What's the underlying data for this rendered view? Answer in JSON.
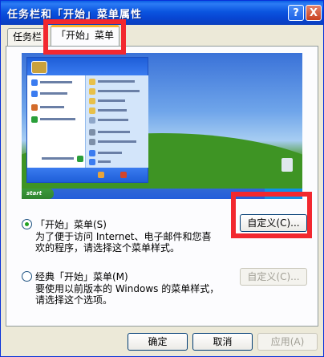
{
  "window": {
    "title": "任务栏和「开始」菜单属性",
    "help_label": "?",
    "close_label": "X"
  },
  "tabs": [
    {
      "label": "任务栏",
      "active": false
    },
    {
      "label": "「开始」菜单",
      "active": true
    }
  ],
  "preview": {
    "start_label": "start",
    "colors": {
      "sky": "#3a72d8",
      "grass": "#2f7e1c",
      "taskbar": "#245edb"
    }
  },
  "options": [
    {
      "label": "「开始」菜单(S)",
      "selected": true,
      "description": [
        "为了便于访问 Internet、电子邮件和您喜",
        "欢的程序，请选择这个菜单样式。"
      ],
      "button_label": "自定义(C)...",
      "button_enabled": true
    },
    {
      "label": "经典「开始」菜单(M)",
      "selected": false,
      "description": [
        "要使用以前版本的 Windows 的菜单样式，",
        "请选择这个选项。"
      ],
      "button_label": "自定义(C)...",
      "button_enabled": false
    }
  ],
  "footer": {
    "ok_label": "确定",
    "cancel_label": "取消",
    "apply_label": "应用(A)"
  },
  "annotation_color": "#f2282f"
}
